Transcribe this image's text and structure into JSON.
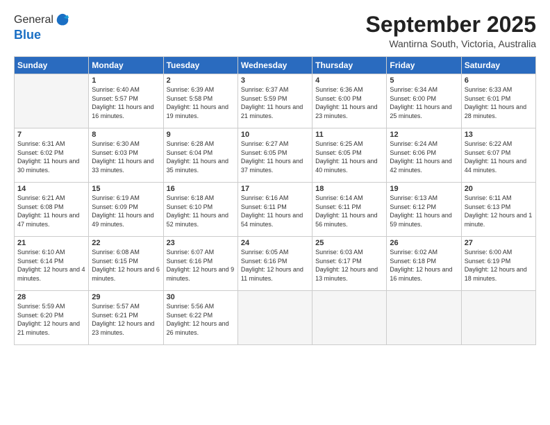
{
  "header": {
    "logo_general": "General",
    "logo_blue": "Blue",
    "month_title": "September 2025",
    "location": "Wantirna South, Victoria, Australia"
  },
  "weekdays": [
    "Sunday",
    "Monday",
    "Tuesday",
    "Wednesday",
    "Thursday",
    "Friday",
    "Saturday"
  ],
  "weeks": [
    [
      {
        "day": "",
        "empty": true
      },
      {
        "day": "1",
        "sunrise": "Sunrise: 6:40 AM",
        "sunset": "Sunset: 5:57 PM",
        "daylight": "Daylight: 11 hours and 16 minutes."
      },
      {
        "day": "2",
        "sunrise": "Sunrise: 6:39 AM",
        "sunset": "Sunset: 5:58 PM",
        "daylight": "Daylight: 11 hours and 19 minutes."
      },
      {
        "day": "3",
        "sunrise": "Sunrise: 6:37 AM",
        "sunset": "Sunset: 5:59 PM",
        "daylight": "Daylight: 11 hours and 21 minutes."
      },
      {
        "day": "4",
        "sunrise": "Sunrise: 6:36 AM",
        "sunset": "Sunset: 6:00 PM",
        "daylight": "Daylight: 11 hours and 23 minutes."
      },
      {
        "day": "5",
        "sunrise": "Sunrise: 6:34 AM",
        "sunset": "Sunset: 6:00 PM",
        "daylight": "Daylight: 11 hours and 25 minutes."
      },
      {
        "day": "6",
        "sunrise": "Sunrise: 6:33 AM",
        "sunset": "Sunset: 6:01 PM",
        "daylight": "Daylight: 11 hours and 28 minutes."
      }
    ],
    [
      {
        "day": "7",
        "sunrise": "Sunrise: 6:31 AM",
        "sunset": "Sunset: 6:02 PM",
        "daylight": "Daylight: 11 hours and 30 minutes."
      },
      {
        "day": "8",
        "sunrise": "Sunrise: 6:30 AM",
        "sunset": "Sunset: 6:03 PM",
        "daylight": "Daylight: 11 hours and 33 minutes."
      },
      {
        "day": "9",
        "sunrise": "Sunrise: 6:28 AM",
        "sunset": "Sunset: 6:04 PM",
        "daylight": "Daylight: 11 hours and 35 minutes."
      },
      {
        "day": "10",
        "sunrise": "Sunrise: 6:27 AM",
        "sunset": "Sunset: 6:05 PM",
        "daylight": "Daylight: 11 hours and 37 minutes."
      },
      {
        "day": "11",
        "sunrise": "Sunrise: 6:25 AM",
        "sunset": "Sunset: 6:05 PM",
        "daylight": "Daylight: 11 hours and 40 minutes."
      },
      {
        "day": "12",
        "sunrise": "Sunrise: 6:24 AM",
        "sunset": "Sunset: 6:06 PM",
        "daylight": "Daylight: 11 hours and 42 minutes."
      },
      {
        "day": "13",
        "sunrise": "Sunrise: 6:22 AM",
        "sunset": "Sunset: 6:07 PM",
        "daylight": "Daylight: 11 hours and 44 minutes."
      }
    ],
    [
      {
        "day": "14",
        "sunrise": "Sunrise: 6:21 AM",
        "sunset": "Sunset: 6:08 PM",
        "daylight": "Daylight: 11 hours and 47 minutes."
      },
      {
        "day": "15",
        "sunrise": "Sunrise: 6:19 AM",
        "sunset": "Sunset: 6:09 PM",
        "daylight": "Daylight: 11 hours and 49 minutes."
      },
      {
        "day": "16",
        "sunrise": "Sunrise: 6:18 AM",
        "sunset": "Sunset: 6:10 PM",
        "daylight": "Daylight: 11 hours and 52 minutes."
      },
      {
        "day": "17",
        "sunrise": "Sunrise: 6:16 AM",
        "sunset": "Sunset: 6:11 PM",
        "daylight": "Daylight: 11 hours and 54 minutes."
      },
      {
        "day": "18",
        "sunrise": "Sunrise: 6:14 AM",
        "sunset": "Sunset: 6:11 PM",
        "daylight": "Daylight: 11 hours and 56 minutes."
      },
      {
        "day": "19",
        "sunrise": "Sunrise: 6:13 AM",
        "sunset": "Sunset: 6:12 PM",
        "daylight": "Daylight: 11 hours and 59 minutes."
      },
      {
        "day": "20",
        "sunrise": "Sunrise: 6:11 AM",
        "sunset": "Sunset: 6:13 PM",
        "daylight": "Daylight: 12 hours and 1 minute."
      }
    ],
    [
      {
        "day": "21",
        "sunrise": "Sunrise: 6:10 AM",
        "sunset": "Sunset: 6:14 PM",
        "daylight": "Daylight: 12 hours and 4 minutes."
      },
      {
        "day": "22",
        "sunrise": "Sunrise: 6:08 AM",
        "sunset": "Sunset: 6:15 PM",
        "daylight": "Daylight: 12 hours and 6 minutes."
      },
      {
        "day": "23",
        "sunrise": "Sunrise: 6:07 AM",
        "sunset": "Sunset: 6:16 PM",
        "daylight": "Daylight: 12 hours and 9 minutes."
      },
      {
        "day": "24",
        "sunrise": "Sunrise: 6:05 AM",
        "sunset": "Sunset: 6:16 PM",
        "daylight": "Daylight: 12 hours and 11 minutes."
      },
      {
        "day": "25",
        "sunrise": "Sunrise: 6:03 AM",
        "sunset": "Sunset: 6:17 PM",
        "daylight": "Daylight: 12 hours and 13 minutes."
      },
      {
        "day": "26",
        "sunrise": "Sunrise: 6:02 AM",
        "sunset": "Sunset: 6:18 PM",
        "daylight": "Daylight: 12 hours and 16 minutes."
      },
      {
        "day": "27",
        "sunrise": "Sunrise: 6:00 AM",
        "sunset": "Sunset: 6:19 PM",
        "daylight": "Daylight: 12 hours and 18 minutes."
      }
    ],
    [
      {
        "day": "28",
        "sunrise": "Sunrise: 5:59 AM",
        "sunset": "Sunset: 6:20 PM",
        "daylight": "Daylight: 12 hours and 21 minutes."
      },
      {
        "day": "29",
        "sunrise": "Sunrise: 5:57 AM",
        "sunset": "Sunset: 6:21 PM",
        "daylight": "Daylight: 12 hours and 23 minutes."
      },
      {
        "day": "30",
        "sunrise": "Sunrise: 5:56 AM",
        "sunset": "Sunset: 6:22 PM",
        "daylight": "Daylight: 12 hours and 26 minutes."
      },
      {
        "day": "",
        "empty": true
      },
      {
        "day": "",
        "empty": true
      },
      {
        "day": "",
        "empty": true
      },
      {
        "day": "",
        "empty": true
      }
    ]
  ]
}
